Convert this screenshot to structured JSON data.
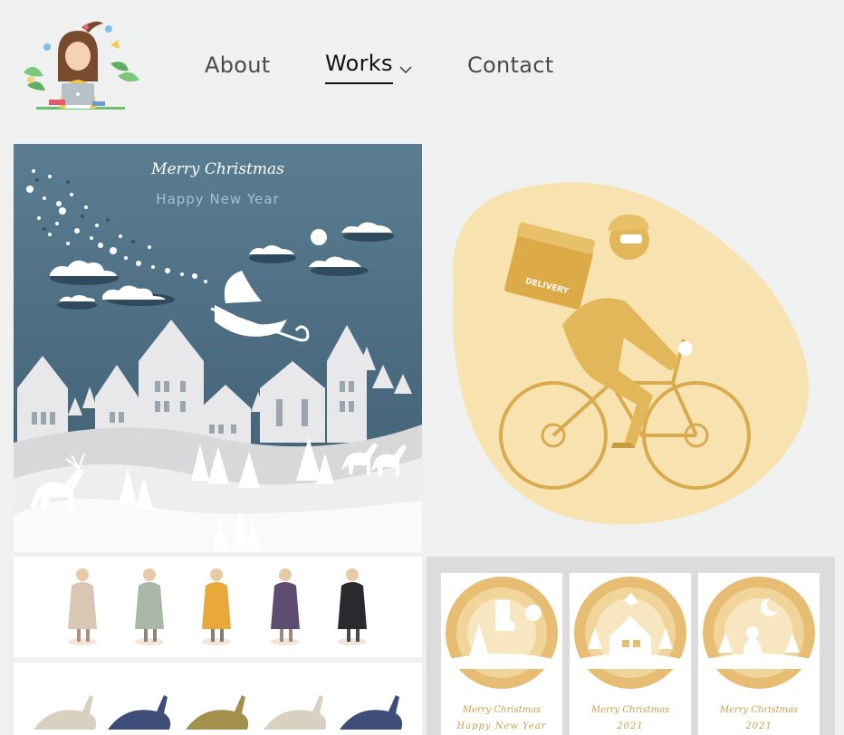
{
  "nav": {
    "about": "About",
    "works": "Works",
    "contact": "Contact"
  },
  "gallery": {
    "xmas": {
      "line1": "Merry Christmas",
      "line2": "Happy New Year"
    },
    "courier": {
      "box_label": "DELIVERY"
    },
    "cards": [
      {
        "line1": "Merry Christmas",
        "line2": "Happy New Year"
      },
      {
        "line1": "Merry Christmas",
        "line2": "2021"
      },
      {
        "line1": "Merry Christmas",
        "line2": "2021"
      }
    ]
  },
  "colors": {
    "background": "#eef1f0",
    "night_sky": "#4a6b7f",
    "gold": "#e2b75a",
    "blob": "#f8e3b0"
  },
  "icons": [
    "logo-illustration-icon",
    "chevron-down-icon"
  ]
}
